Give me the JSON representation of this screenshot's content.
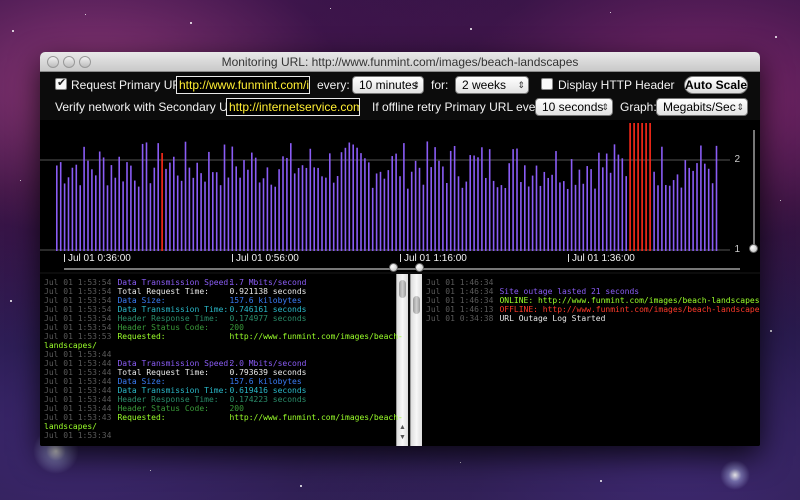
{
  "window": {
    "title": "Monitoring URL: http://www.funmint.com/images/beach-landscapes"
  },
  "controls": {
    "request_primary_label": "Request Primary URL:",
    "request_primary_checked": true,
    "primary_url": "http://www.funmint.com/images/beach-landscapes",
    "every_label": "every:",
    "every_value": "10 minutes",
    "for_label": "for:",
    "for_value": "2 weeks",
    "display_http_header_label": "Display HTTP Header",
    "display_http_header_checked": false,
    "auto_scale_label": "Auto Scale",
    "verify_label": "Verify network with Secondary URL:",
    "secondary_url": "http://internetservice.com",
    "retry_label": "If offline retry Primary URL every:",
    "retry_value": "10 seconds",
    "graph_label": "Graph:",
    "graph_value": "Megabits/Sec"
  },
  "graph": {
    "y_labels": [
      "2",
      "1"
    ],
    "time_labels": [
      "Jul 01 0:36:00",
      "Jul 01 0:56:00",
      "Jul 01 1:16:00",
      "Jul 01 1:36:00"
    ],
    "bar_color": "#8a5cf5",
    "outage_color": "#ff2a1a",
    "scroll_position": 0.55
  },
  "left_log": [
    {
      "time": "Jul 01 1:53:54",
      "label": "Data Transmission Speed:",
      "value": "1.7 Mbits/second",
      "color": "#8a5cf5"
    },
    {
      "time": "Jul 01 1:53:54",
      "label": "Total Request Time:",
      "value": "0.921138 seconds",
      "color": "#e8e8e8"
    },
    {
      "time": "Jul 01 1:53:54",
      "label": "Data Size:",
      "value": "157.6 kilobytes",
      "color": "#3a7cf5"
    },
    {
      "time": "Jul 01 1:53:54",
      "label": "Data Transmission Time:",
      "value": "0.746161 seconds",
      "color": "#2ab8c8"
    },
    {
      "time": "Jul 01 1:53:54",
      "label": "Header Response Time:",
      "value": "0.174977 seconds",
      "color": "#2a8c6a"
    },
    {
      "time": "Jul 01 1:53:54",
      "label": "Header Status Code:",
      "value": "200",
      "color": "#3a9a3a"
    },
    {
      "time": "Jul 01 1:53:53",
      "label": "Requested:",
      "value": "http://www.funmint.com/images/beach-",
      "color": "#9aff2a"
    },
    {
      "time": "",
      "label": "landscapes/",
      "value": "",
      "color": "#9aff2a"
    },
    {
      "time": "Jul 01 1:53:44",
      "label": "",
      "value": "",
      "color": "#e8e8e8"
    },
    {
      "time": "Jul 01 1:53:44",
      "label": "Data Transmission Speed:",
      "value": "2.0 Mbits/second",
      "color": "#8a5cf5"
    },
    {
      "time": "Jul 01 1:53:44",
      "label": "Total Request Time:",
      "value": "0.793639 seconds",
      "color": "#e8e8e8"
    },
    {
      "time": "Jul 01 1:53:44",
      "label": "Data Size:",
      "value": "157.6 kilobytes",
      "color": "#3a7cf5"
    },
    {
      "time": "Jul 01 1:53:44",
      "label": "Data Transmission Time:",
      "value": "0.619416 seconds",
      "color": "#2ab8c8"
    },
    {
      "time": "Jul 01 1:53:44",
      "label": "Header Response Time:",
      "value": "0.174223 seconds",
      "color": "#2a8c6a"
    },
    {
      "time": "Jul 01 1:53:44",
      "label": "Header Status Code:",
      "value": "200",
      "color": "#3a9a3a"
    },
    {
      "time": "Jul 01 1:53:43",
      "label": "Requested:",
      "value": "http://www.funmint.com/images/beach-",
      "color": "#9aff2a"
    },
    {
      "time": "",
      "label": "landscapes/",
      "value": "",
      "color": "#9aff2a"
    },
    {
      "time": "Jul 01 1:53:34",
      "label": "",
      "value": "",
      "color": "#e8e8e8"
    }
  ],
  "right_log": [
    {
      "time": "Jul 01 1:46:34",
      "text": "",
      "color": "#e8e8e8"
    },
    {
      "time": "Jul 01 1:46:34",
      "text": "Site outage lasted 21 seconds",
      "color": "#8a5cf5"
    },
    {
      "time": "Jul 01 1:46:34",
      "text": "ONLINE: http://www.funmint.com/images/beach-landscapes/",
      "color": "#9aff2a"
    },
    {
      "time": "Jul 01 1:46:13",
      "text": "OFFLINE: http://www.funmint.com/images/beach-landscapes/",
      "color": "#ff3a2a"
    },
    {
      "time": "Jul 01 0:34:38",
      "text": "URL Outage Log Started",
      "color": "#e8e8e8"
    }
  ]
}
